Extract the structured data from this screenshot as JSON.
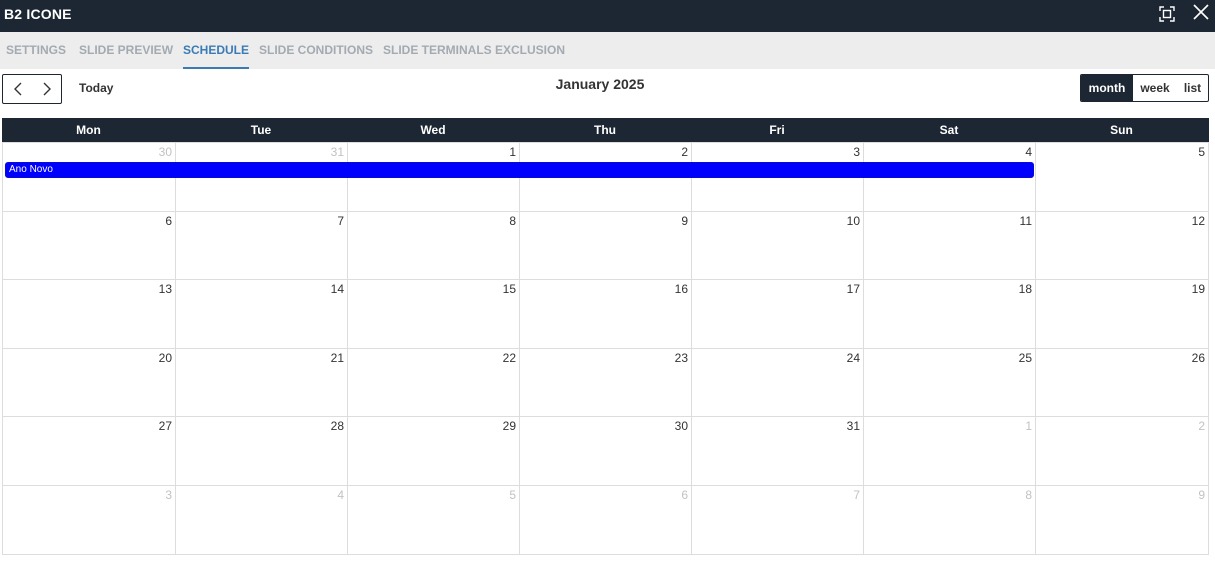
{
  "window": {
    "title": "B2 ICONE",
    "maximize_icon": "maximize-icon",
    "close_icon": "close-icon"
  },
  "tabs": [
    {
      "label": "SETTINGS",
      "active": false
    },
    {
      "label": "SLIDE PREVIEW",
      "active": false
    },
    {
      "label": "SCHEDULE",
      "active": true
    },
    {
      "label": "SLIDE CONDITIONS",
      "active": false
    },
    {
      "label": "SLIDE TERMINALS EXCLUSION",
      "active": false
    }
  ],
  "toolbar": {
    "prev_icon": "chevron-left-icon",
    "next_icon": "chevron-right-icon",
    "today_label": "Today",
    "title": "January 2025",
    "views": [
      {
        "label": "month",
        "active": true
      },
      {
        "label": "week",
        "active": false
      },
      {
        "label": "list",
        "active": false
      }
    ]
  },
  "calendar": {
    "weekdays": [
      "Mon",
      "Tue",
      "Wed",
      "Thu",
      "Fri",
      "Sat",
      "Sun"
    ],
    "weeks": [
      [
        {
          "day": "30",
          "other": true
        },
        {
          "day": "31",
          "other": true
        },
        {
          "day": "1"
        },
        {
          "day": "2"
        },
        {
          "day": "3"
        },
        {
          "day": "4"
        },
        {
          "day": "5"
        }
      ],
      [
        {
          "day": "6"
        },
        {
          "day": "7"
        },
        {
          "day": "8"
        },
        {
          "day": "9"
        },
        {
          "day": "10"
        },
        {
          "day": "11"
        },
        {
          "day": "12"
        }
      ],
      [
        {
          "day": "13"
        },
        {
          "day": "14"
        },
        {
          "day": "15"
        },
        {
          "day": "16"
        },
        {
          "day": "17"
        },
        {
          "day": "18"
        },
        {
          "day": "19"
        }
      ],
      [
        {
          "day": "20"
        },
        {
          "day": "21"
        },
        {
          "day": "22"
        },
        {
          "day": "23"
        },
        {
          "day": "24"
        },
        {
          "day": "25"
        },
        {
          "day": "26"
        }
      ],
      [
        {
          "day": "27"
        },
        {
          "day": "28"
        },
        {
          "day": "29"
        },
        {
          "day": "30"
        },
        {
          "day": "31"
        },
        {
          "day": "1",
          "other": true
        },
        {
          "day": "2",
          "other": true
        }
      ],
      [
        {
          "day": "3",
          "other": true
        },
        {
          "day": "4",
          "other": true
        },
        {
          "day": "5",
          "other": true
        },
        {
          "day": "6",
          "other": true
        },
        {
          "day": "7",
          "other": true
        },
        {
          "day": "8",
          "other": true
        },
        {
          "day": "9",
          "other": true
        }
      ]
    ],
    "events": [
      {
        "title": "Ano Novo",
        "start": "2024-12-30",
        "end": "2025-01-04",
        "color": "#0000ff"
      }
    ]
  },
  "colors": {
    "header_bg": "#1c2733",
    "accent": "#3b7bb5",
    "event": "#0000ff"
  }
}
